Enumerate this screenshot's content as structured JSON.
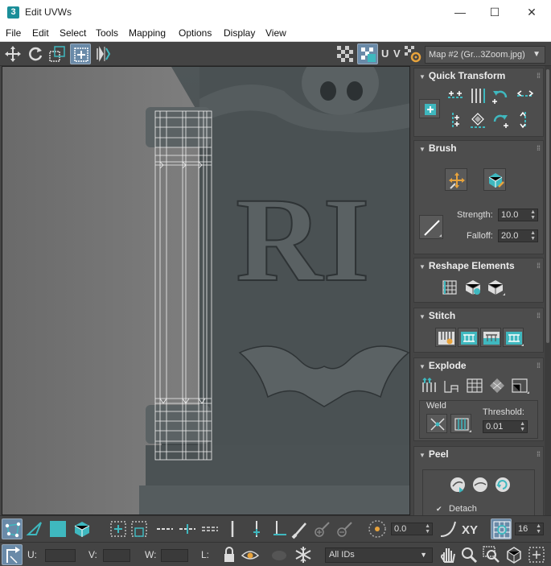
{
  "window": {
    "app_icon_text": "3",
    "title": "Edit UVWs",
    "minimize": "—",
    "maximize": "☐",
    "close": "✕"
  },
  "menu": [
    "File",
    "Edit",
    "Select",
    "Tools",
    "Mapping",
    "Options",
    "Display",
    "View"
  ],
  "toolbar": {
    "uv_label": "U V",
    "map_dropdown": "Map #2 (Gr...3Zoom.jpg)"
  },
  "viewport": {
    "tombstone_text": "RI"
  },
  "panel": {
    "quick_transform": {
      "title": "Quick Transform"
    },
    "brush": {
      "title": "Brush",
      "strength_label": "Strength:",
      "strength_value": "10.0",
      "falloff_label": "Falloff:",
      "falloff_value": "20.0"
    },
    "reshape": {
      "title": "Reshape Elements"
    },
    "stitch": {
      "title": "Stitch"
    },
    "explode": {
      "title": "Explode",
      "weld_label": "Weld",
      "threshold_label": "Threshold:",
      "threshold_value": "0.01"
    },
    "peel": {
      "title": "Peel",
      "detach_label": "Detach",
      "detach_checked": true
    }
  },
  "bottom1": {
    "angle_value": "0.0",
    "xy_label": "XY",
    "grid_value": "16"
  },
  "bottom2": {
    "u_label": "U:",
    "v_label": "V:",
    "w_label": "W:",
    "l_label": "L:",
    "ids_dropdown": "All IDs"
  },
  "colors": {
    "accent": "#3fb8bf",
    "panel_bg": "#4d4d4d",
    "toolbar_bg": "#444444"
  }
}
